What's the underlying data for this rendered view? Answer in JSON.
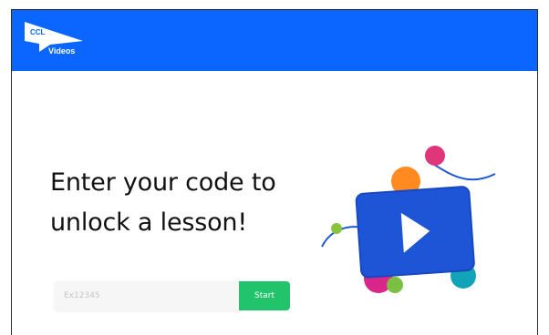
{
  "header": {
    "background": "#0a66ff",
    "logo": {
      "brand": "CCL",
      "product": "Videos",
      "icon": "ccl-flag-icon"
    }
  },
  "main": {
    "headline_line1": "Enter your code to",
    "headline_line2": "unlock a lesson!",
    "code_input": {
      "value": "",
      "placeholder": "Ex12345"
    },
    "start_button_label": "Start",
    "illustration_icon": "play-video-icon"
  },
  "colors": {
    "accent": "#0a66ff",
    "button": "#22c46b",
    "play_card": "#1e55d6"
  }
}
